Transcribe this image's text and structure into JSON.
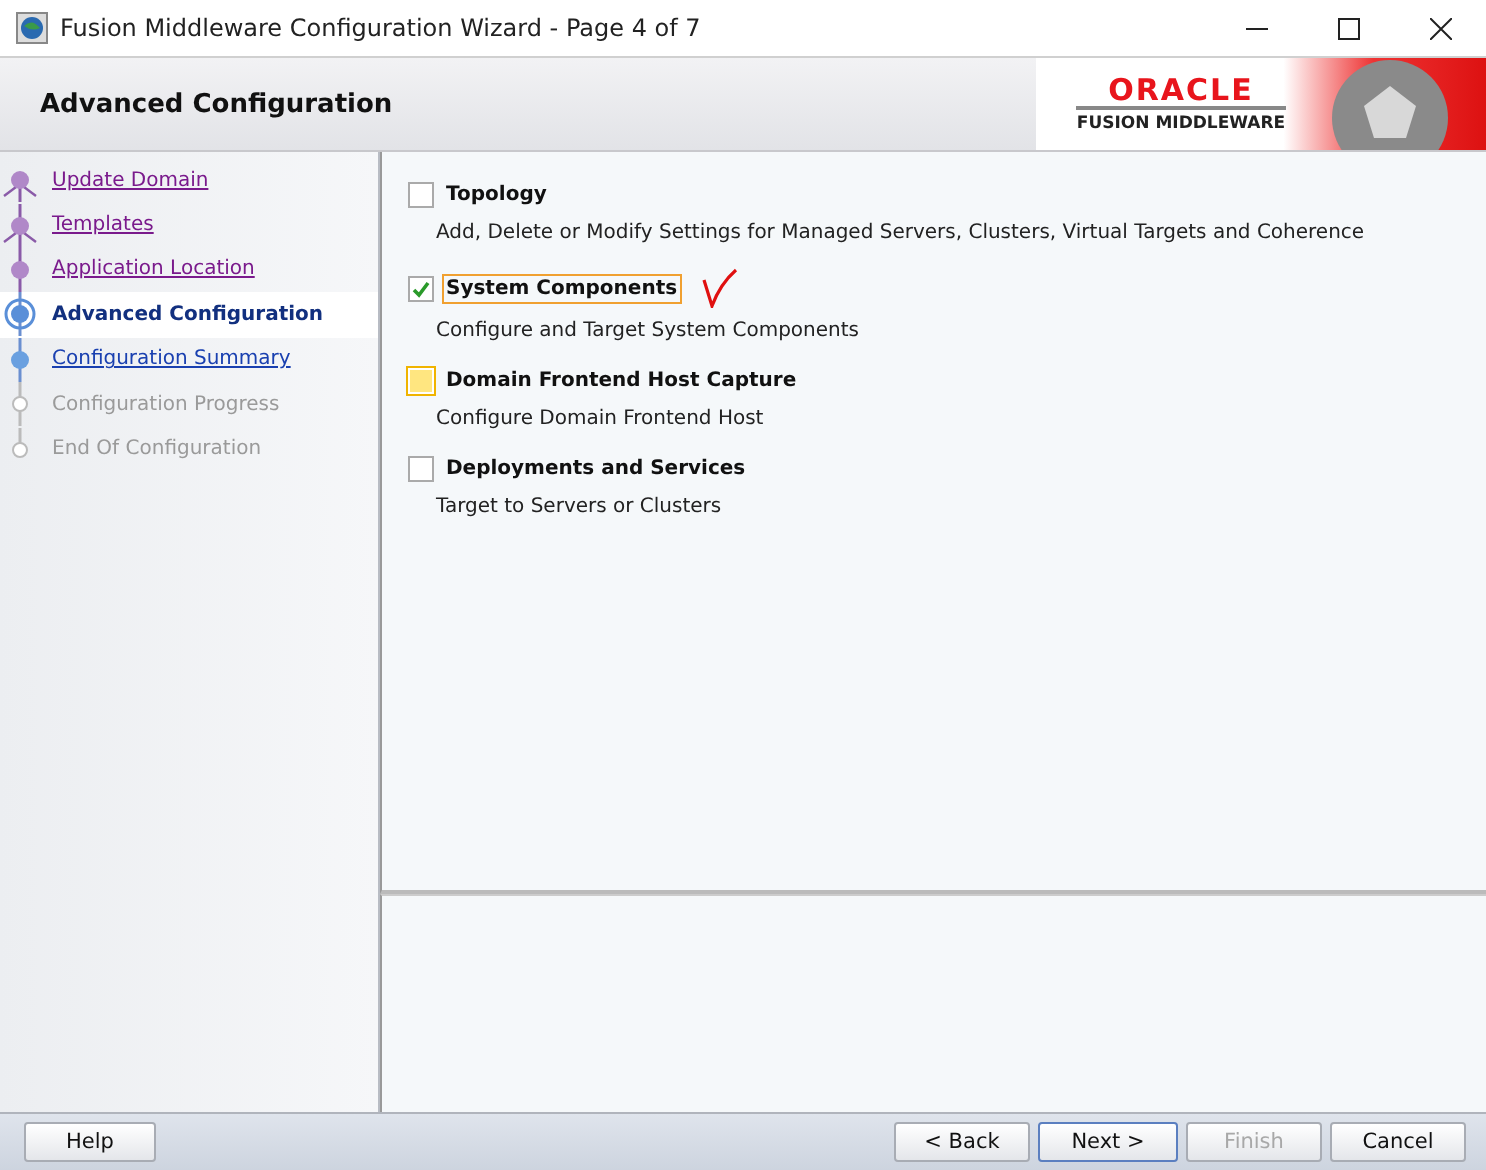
{
  "window": {
    "title": "Fusion Middleware Configuration Wizard - Page 4 of 7"
  },
  "header": {
    "title": "Advanced Configuration",
    "logo_brand": "ORACLE",
    "logo_product": "FUSION MIDDLEWARE"
  },
  "steps": [
    {
      "label": "Update Domain",
      "kind": "visited",
      "selected": false
    },
    {
      "label": "Templates",
      "kind": "visited",
      "selected": false
    },
    {
      "label": "Application Location",
      "kind": "visited",
      "selected": false
    },
    {
      "label": "Advanced Configuration",
      "kind": "current",
      "selected": true
    },
    {
      "label": "Configuration Summary",
      "kind": "next",
      "selected": false
    },
    {
      "label": "Configuration Progress",
      "kind": "disabled",
      "selected": false
    },
    {
      "label": "End Of Configuration",
      "kind": "disabled",
      "selected": false
    }
  ],
  "options": [
    {
      "label": "Topology",
      "description": "Add, Delete or Modify Settings for Managed Servers, Clusters, Virtual Targets and Coherence",
      "checked": false,
      "focused": false,
      "highlighted": false
    },
    {
      "label": "System Components",
      "description": "Configure and Target System Components",
      "checked": true,
      "focused": true,
      "highlighted": false,
      "annotated": true
    },
    {
      "label": "Domain Frontend Host Capture",
      "description": "Configure Domain Frontend Host",
      "checked": false,
      "focused": false,
      "highlighted": true
    },
    {
      "label": "Deployments and Services",
      "description": "Target to Servers or Clusters",
      "checked": false,
      "focused": false,
      "highlighted": false
    }
  ],
  "buttons": [
    {
      "label": "Help",
      "disabled": false,
      "default": false
    },
    {
      "label": "< Back",
      "disabled": false,
      "default": false
    },
    {
      "label": "Next >",
      "disabled": false,
      "default": true
    },
    {
      "label": "Finish",
      "disabled": true,
      "default": false
    },
    {
      "label": "Cancel",
      "disabled": false,
      "default": false
    }
  ]
}
